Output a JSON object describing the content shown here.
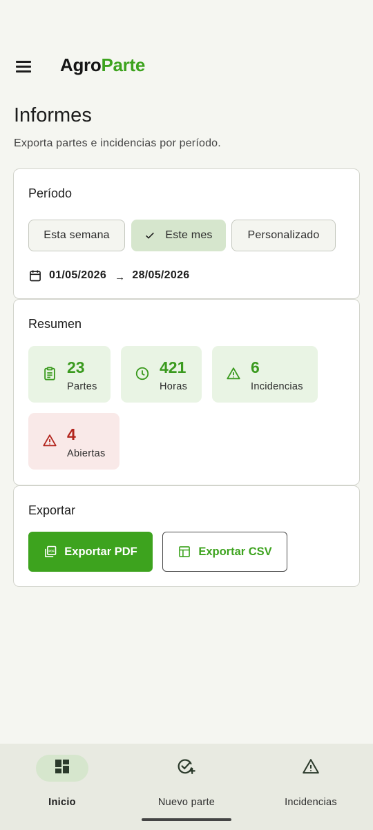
{
  "app": {
    "brand_part1": "Agro",
    "brand_part2": "Parte",
    "menu_icon": "menu-icon"
  },
  "page": {
    "title": "Informes",
    "subtitle": "Exporta partes e incidencias por período."
  },
  "period": {
    "title": "Período",
    "options": [
      {
        "label": "Esta semana",
        "selected": false
      },
      {
        "label": "Este mes",
        "selected": true
      },
      {
        "label": "Personalizado",
        "selected": false
      }
    ],
    "start_date": "01/05/2026",
    "arrow": "→",
    "end_date": "28/05/2026"
  },
  "summary": {
    "title": "Resumen",
    "stats": [
      {
        "value": "23",
        "label": "Partes",
        "icon": "clipboard-icon",
        "tone": "green"
      },
      {
        "value": "421",
        "label": "Horas",
        "icon": "clock-icon",
        "tone": "green"
      },
      {
        "value": "6",
        "label": "Incidencias",
        "icon": "warning-icon",
        "tone": "green"
      },
      {
        "value": "4",
        "label": "Abiertas",
        "icon": "warning-icon",
        "tone": "red"
      }
    ]
  },
  "export": {
    "title": "Exportar",
    "pdf_label": "Exportar PDF",
    "csv_label": "Exportar CSV"
  },
  "nav": {
    "items": [
      {
        "label": "Inicio",
        "icon": "dashboard-icon",
        "active": true
      },
      {
        "label": "Nuevo parte",
        "icon": "add-check-icon",
        "active": false
      },
      {
        "label": "Incidencias",
        "icon": "warning-icon",
        "active": false
      }
    ]
  },
  "colors": {
    "accent": "#3da31e",
    "background": "#f5f6f1",
    "chip_selected": "#d6e6cd",
    "stat_green_bg": "#e9f4e4",
    "stat_red_bg": "#f9e9e8",
    "danger": "#b3261e"
  }
}
